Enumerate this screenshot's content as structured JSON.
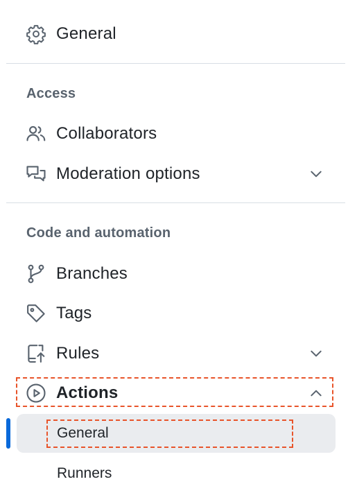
{
  "sidebar": {
    "top_item": {
      "label": "General",
      "icon": "gear-icon"
    },
    "sections": [
      {
        "heading": "Access",
        "items": [
          {
            "label": "Collaborators",
            "icon": "people-icon"
          },
          {
            "label": "Moderation options",
            "icon": "comment-discussion-icon",
            "expandable": true,
            "expanded": false
          }
        ]
      },
      {
        "heading": "Code and automation",
        "items": [
          {
            "label": "Branches",
            "icon": "git-branch-icon"
          },
          {
            "label": "Tags",
            "icon": "tag-icon"
          },
          {
            "label": "Rules",
            "icon": "repo-push-icon",
            "expandable": true,
            "expanded": false
          },
          {
            "label": "Actions",
            "icon": "play-icon",
            "expandable": true,
            "expanded": true,
            "sub_items": [
              {
                "label": "General",
                "selected": true
              },
              {
                "label": "Runners",
                "selected": false
              }
            ]
          }
        ]
      }
    ]
  },
  "colors": {
    "text": "#1f2328",
    "muted_heading": "#59636e",
    "icon": "#59636e",
    "divider": "#d8dee4",
    "selected_bg": "#eaecef",
    "accent": "#0969da",
    "highlight": "#e8542a"
  }
}
